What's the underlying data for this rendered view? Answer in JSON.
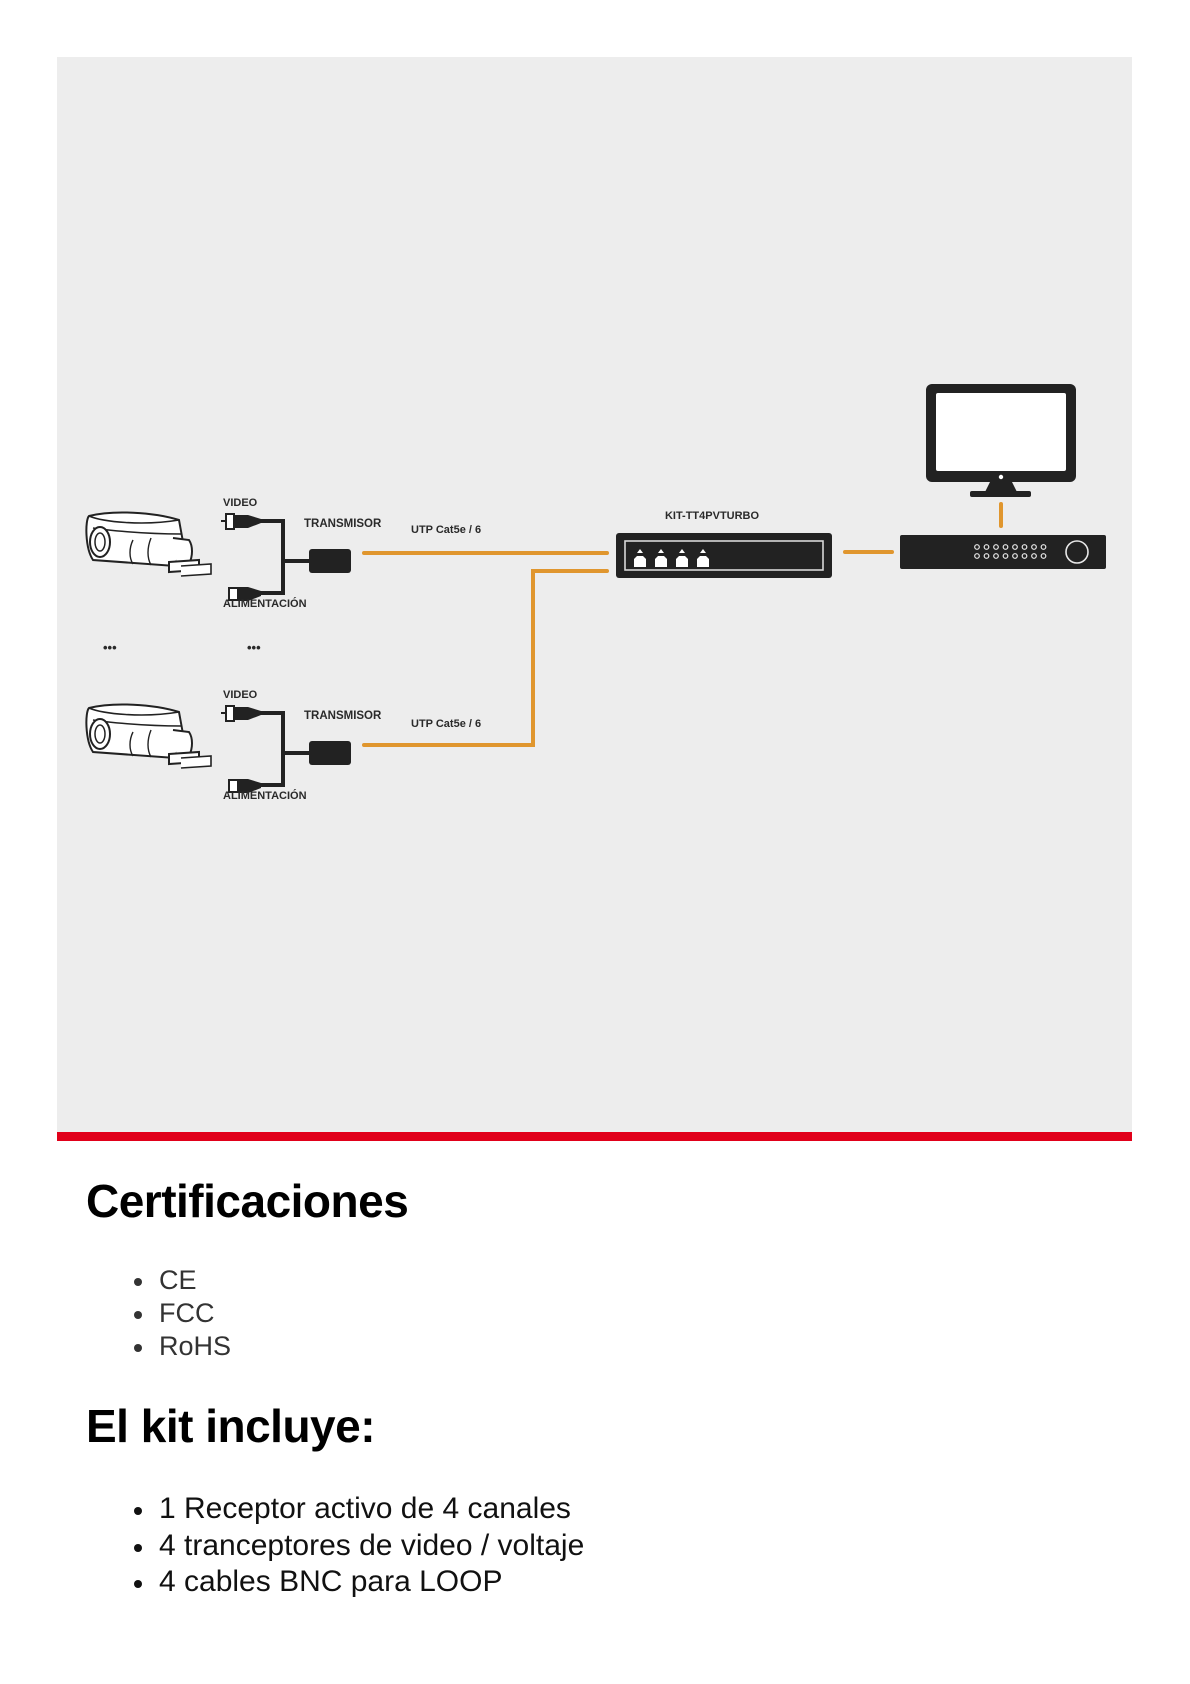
{
  "diagram": {
    "camera_groups": [
      {
        "video_label": "VIDEO",
        "transmitter_label": "TRANSMISOR",
        "power_label": "ALIMENTACIÓN",
        "cable_label": "UTP Cat5e / 6"
      },
      {
        "video_label": "VIDEO",
        "transmitter_label": "TRANSMISOR",
        "power_label": "ALIMENTACIÓN",
        "cable_label": "UTP Cat5e / 6"
      }
    ],
    "ellipsis": "•••",
    "receiver_label": "KIT-TT4PVTURBO",
    "receiver_ports": 4,
    "colors": {
      "panel_bg": "#ededed",
      "cable": "#e0962e",
      "device": "#222222",
      "accent_rule": "#e1001a"
    }
  },
  "certifications": {
    "heading": "Certificaciones",
    "items": [
      "CE",
      "FCC",
      "RoHS"
    ]
  },
  "kit": {
    "heading": "El kit incluye:",
    "items": [
      "1 Receptor activo de 4 canales",
      "4 tranceptores de video / voltaje",
      "4 cables BNC para LOOP"
    ]
  }
}
